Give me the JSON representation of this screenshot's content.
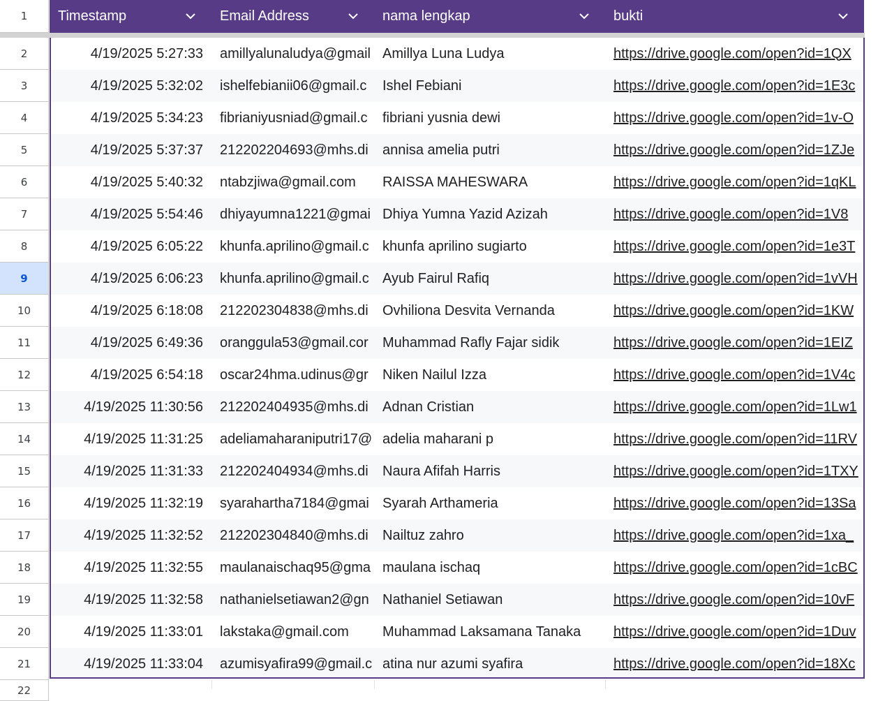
{
  "colors": {
    "header_bg": "#573b86",
    "header_text": "#ffffff",
    "band": "#f7f8fa",
    "selected_row_bg": "#d3e3fd"
  },
  "header_row_number": "1",
  "selected_row": "9",
  "columns": [
    "Timestamp",
    "Email Address",
    "nama lengkap",
    "bukti"
  ],
  "column_icon": "chevron-down-icon",
  "rows": [
    {
      "n": "2",
      "ts": "4/19/2025 5:27:33",
      "email": "amillyalunaludya@gmail",
      "name": "Amillya Luna Ludya",
      "bukti": "https://drive.google.com/open?id=1QX"
    },
    {
      "n": "3",
      "ts": "4/19/2025 5:32:02",
      "email": "ishelfebianii06@gmail.c",
      "name": "Ishel Febiani",
      "bukti": "https://drive.google.com/open?id=1E3c"
    },
    {
      "n": "4",
      "ts": "4/19/2025 5:34:23",
      "email": "fibrianiyusniad@gmail.c",
      "name": "fibriani yusnia dewi",
      "bukti": "https://drive.google.com/open?id=1v-O"
    },
    {
      "n": "5",
      "ts": "4/19/2025 5:37:37",
      "email": "212202204693@mhs.di",
      "name": "annisa amelia putri",
      "bukti": "https://drive.google.com/open?id=1ZJe"
    },
    {
      "n": "6",
      "ts": "4/19/2025 5:40:32",
      "email": "ntabzjiwa@gmail.com",
      "name": "RAISSA MAHESWARA",
      "bukti": "https://drive.google.com/open?id=1qKL"
    },
    {
      "n": "7",
      "ts": "4/19/2025 5:54:46",
      "email": "dhiyayumna1221@gmai",
      "name": "Dhiya Yumna Yazid Azizah",
      "bukti": "https://drive.google.com/open?id=1V8"
    },
    {
      "n": "8",
      "ts": "4/19/2025 6:05:22",
      "email": "khunfa.aprilino@gmail.c",
      "name": "khunfa aprilino sugiarto",
      "bukti": "https://drive.google.com/open?id=1e3T"
    },
    {
      "n": "9",
      "ts": "4/19/2025 6:06:23",
      "email": "khunfa.aprilino@gmail.c",
      "name": "Ayub Fairul Rafiq",
      "bukti": "https://drive.google.com/open?id=1vVH"
    },
    {
      "n": "10",
      "ts": "4/19/2025 6:18:08",
      "email": "212202304838@mhs.di",
      "name": "Ovhiliona Desvita Vernanda",
      "bukti": "https://drive.google.com/open?id=1KW"
    },
    {
      "n": "11",
      "ts": "4/19/2025 6:49:36",
      "email": "oranggula53@gmail.cor",
      "name": "Muhammad Rafly Fajar sidik",
      "bukti": "https://drive.google.com/open?id=1EIZ"
    },
    {
      "n": "12",
      "ts": "4/19/2025 6:54:18",
      "email": "oscar24hma.udinus@gr",
      "name": "Niken Nailul Izza",
      "bukti": "https://drive.google.com/open?id=1V4c"
    },
    {
      "n": "13",
      "ts": "4/19/2025 11:30:56",
      "email": "212202404935@mhs.di",
      "name": "Adnan Cristian",
      "bukti": "https://drive.google.com/open?id=1Lw1"
    },
    {
      "n": "14",
      "ts": "4/19/2025 11:31:25",
      "email": "adeliamaharaniputri17@",
      "name": "adelia maharani p",
      "bukti": "https://drive.google.com/open?id=11RV"
    },
    {
      "n": "15",
      "ts": "4/19/2025 11:31:33",
      "email": "212202404934@mhs.di",
      "name": "Naura Afifah Harris",
      "bukti": "https://drive.google.com/open?id=1TXY"
    },
    {
      "n": "16",
      "ts": "4/19/2025 11:32:19",
      "email": "syarahartha7184@gmai",
      "name": "Syarah Arthameria",
      "bukti": "https://drive.google.com/open?id=13Sa"
    },
    {
      "n": "17",
      "ts": "4/19/2025 11:32:52",
      "email": "212202304840@mhs.di",
      "name": "Nailtuz zahro",
      "bukti": "https://drive.google.com/open?id=1xa_"
    },
    {
      "n": "18",
      "ts": "4/19/2025 11:32:55",
      "email": "maulanaischaq95@gma",
      "name": "maulana ischaq",
      "bukti": "https://drive.google.com/open?id=1cBC"
    },
    {
      "n": "19",
      "ts": "4/19/2025 11:32:58",
      "email": "nathanielsetiawan2@gn",
      "name": "Nathaniel Setiawan",
      "bukti": "https://drive.google.com/open?id=10vF"
    },
    {
      "n": "20",
      "ts": "4/19/2025 11:33:01",
      "email": "lakstaka@gmail.com",
      "name": "Muhammad Laksamana Tanaka",
      "bukti": "https://drive.google.com/open?id=1Duv"
    },
    {
      "n": "21",
      "ts": "4/19/2025 11:33:04",
      "email": "azumisyafira99@gmail.c",
      "name": "atina nur azumi syafira",
      "bukti": "https://drive.google.com/open?id=18Xc"
    }
  ],
  "next_row_number": "22"
}
